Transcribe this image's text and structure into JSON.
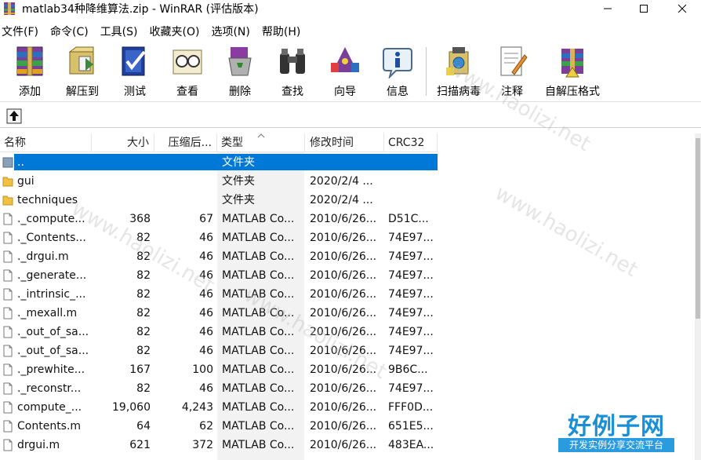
{
  "window": {
    "title": "matlab34种降维算法.zip - WinRAR (评估版本)",
    "buttons": {
      "minimize": "─",
      "maximize": "□",
      "close": "✕"
    }
  },
  "menu": [
    "文件(F)",
    "命令(C)",
    "工具(S)",
    "收藏夹(O)",
    "选项(N)",
    "帮助(H)"
  ],
  "toolbar": [
    {
      "label": "添加",
      "icon": "add-archive-icon"
    },
    {
      "label": "解压到",
      "icon": "extract-to-icon"
    },
    {
      "label": "测试",
      "icon": "test-icon"
    },
    {
      "label": "查看",
      "icon": "view-icon"
    },
    {
      "label": "删除",
      "icon": "delete-icon"
    },
    {
      "label": "查找",
      "icon": "find-icon"
    },
    {
      "label": "向导",
      "icon": "wizard-icon"
    },
    {
      "label": "信息",
      "icon": "info-icon"
    },
    {
      "label": "扫描病毒",
      "icon": "virus-scan-icon"
    },
    {
      "label": "注释",
      "icon": "comment-icon"
    },
    {
      "label": "自解压格式",
      "icon": "sfx-icon"
    }
  ],
  "columns": {
    "name": "名称",
    "size": "大小",
    "packed": "压缩后...",
    "type": "类型",
    "modified": "修改时间",
    "crc": "CRC32"
  },
  "files": [
    {
      "name": "..",
      "size": "",
      "packed": "",
      "type": "文件夹",
      "modified": "",
      "crc": "",
      "kind": "parent",
      "selected": true
    },
    {
      "name": "gui",
      "size": "",
      "packed": "",
      "type": "文件夹",
      "modified": "2020/2/4 ...",
      "crc": "",
      "kind": "folder"
    },
    {
      "name": "techniques",
      "size": "",
      "packed": "",
      "type": "文件夹",
      "modified": "2020/2/4 ...",
      "crc": "",
      "kind": "folder"
    },
    {
      "name": "._compute...",
      "size": "368",
      "packed": "67",
      "type": "MATLAB Co...",
      "modified": "2010/6/26...",
      "crc": "D51C...",
      "kind": "file"
    },
    {
      "name": "._Contents...",
      "size": "82",
      "packed": "46",
      "type": "MATLAB Co...",
      "modified": "2010/6/26...",
      "crc": "74E97...",
      "kind": "file"
    },
    {
      "name": "._drgui.m",
      "size": "82",
      "packed": "46",
      "type": "MATLAB Co...",
      "modified": "2010/6/26...",
      "crc": "74E97...",
      "kind": "file"
    },
    {
      "name": "._generate...",
      "size": "82",
      "packed": "46",
      "type": "MATLAB Co...",
      "modified": "2010/6/26...",
      "crc": "74E97...",
      "kind": "file"
    },
    {
      "name": "._intrinsic_...",
      "size": "82",
      "packed": "46",
      "type": "MATLAB Co...",
      "modified": "2010/6/26...",
      "crc": "74E97...",
      "kind": "file"
    },
    {
      "name": "._mexall.m",
      "size": "82",
      "packed": "46",
      "type": "MATLAB Co...",
      "modified": "2010/6/26...",
      "crc": "74E97...",
      "kind": "file"
    },
    {
      "name": "._out_of_sa...",
      "size": "82",
      "packed": "46",
      "type": "MATLAB Co...",
      "modified": "2010/6/26...",
      "crc": "74E97...",
      "kind": "file"
    },
    {
      "name": "._out_of_sa...",
      "size": "82",
      "packed": "46",
      "type": "MATLAB Co...",
      "modified": "2010/6/26...",
      "crc": "74E97...",
      "kind": "file"
    },
    {
      "name": "._prewhite...",
      "size": "167",
      "packed": "100",
      "type": "MATLAB Co...",
      "modified": "2010/6/26...",
      "crc": "9B6C...",
      "kind": "file"
    },
    {
      "name": "._reconstr...",
      "size": "82",
      "packed": "46",
      "type": "MATLAB Co...",
      "modified": "2010/6/26...",
      "crc": "74E97...",
      "kind": "file"
    },
    {
      "name": "compute_...",
      "size": "19,060",
      "packed": "4,243",
      "type": "MATLAB Co...",
      "modified": "2010/6/26...",
      "crc": "FFF0D...",
      "kind": "file"
    },
    {
      "name": "Contents.m",
      "size": "64",
      "packed": "62",
      "type": "MATLAB Co...",
      "modified": "2010/6/26...",
      "crc": "651E5...",
      "kind": "file"
    },
    {
      "name": "drgui.m",
      "size": "621",
      "packed": "372",
      "type": "MATLAB Co...",
      "modified": "2010/6/26...",
      "crc": "483EA...",
      "kind": "file"
    }
  ],
  "watermark": {
    "text": "www.haolizi.net",
    "brand": "好例子网",
    "brand_sub": "开发实例分享交流平台"
  },
  "colors": {
    "selection": "#0078d7",
    "folder": "#f0c040",
    "brand": "#1a8fd6"
  }
}
